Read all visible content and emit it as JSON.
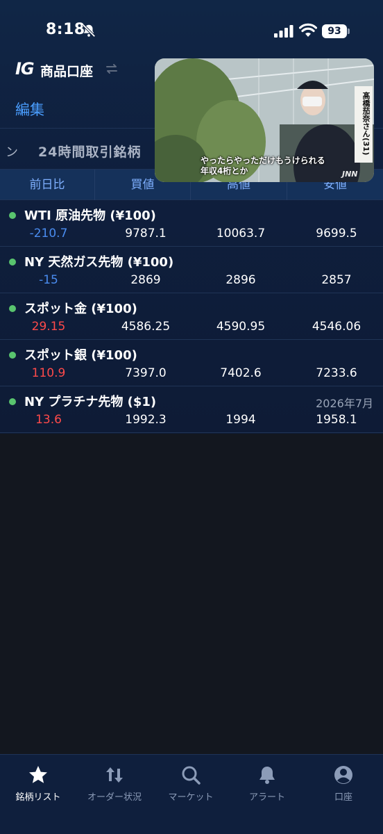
{
  "status_bar": {
    "time": "8:18",
    "battery": "93"
  },
  "header": {
    "logo": "IG",
    "account_title": "商品口座",
    "edit_label": "編集"
  },
  "tabs": {
    "partial_label": "ン",
    "active_label": "24時間取引銘柄"
  },
  "columns": [
    "前日比",
    "買値",
    "高値",
    "安値"
  ],
  "instruments": [
    {
      "name": "WTI 原油先物 (¥100)",
      "expiry": "",
      "change": "-210.7",
      "change_sign": "neg",
      "bid": "9787.1",
      "high": "10063.7",
      "low": "9699.5"
    },
    {
      "name": "NY 天然ガス先物 (¥100)",
      "expiry": "",
      "change": "-15",
      "change_sign": "neg",
      "bid": "2869",
      "high": "2896",
      "low": "2857"
    },
    {
      "name": "スポット金 (¥100)",
      "expiry": "",
      "change": "29.15",
      "change_sign": "pos",
      "bid": "4586.25",
      "high": "4590.95",
      "low": "4546.06"
    },
    {
      "name": "スポット銀 (¥100)",
      "expiry": "",
      "change": "110.9",
      "change_sign": "pos",
      "bid": "7397.0",
      "high": "7402.6",
      "low": "7233.6"
    },
    {
      "name": "NY プラチナ先物 ($1)",
      "expiry": "2026年7月",
      "change": "13.6",
      "change_sign": "pos",
      "bid": "1992.3",
      "high": "1994",
      "low": "1958.1"
    }
  ],
  "video": {
    "caption_line1": "やったらやっただけもうけられる",
    "caption_line2": "年収4桁とか",
    "vertical_text": "髙橋茄奈さん(31)",
    "watermark": "JNN"
  },
  "bottom_nav": [
    {
      "label": "銘柄リスト",
      "icon": "star-icon",
      "active": true
    },
    {
      "label": "オーダー状況",
      "icon": "arrows-updown-icon",
      "active": false
    },
    {
      "label": "マーケット",
      "icon": "search-icon",
      "active": false
    },
    {
      "label": "アラート",
      "icon": "bell-icon",
      "active": false
    },
    {
      "label": "口座",
      "icon": "account-icon",
      "active": false
    }
  ],
  "colors": {
    "accent": "#4a9eff",
    "negative": "#4a8cf0",
    "positive": "#ff4a4a",
    "status_dot": "#59c46e",
    "background": "#0f1f3d"
  }
}
